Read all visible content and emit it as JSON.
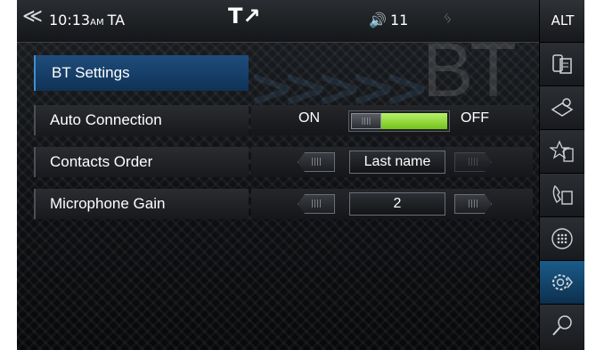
{
  "status": {
    "time": "10:13",
    "ampm": "AM",
    "station": "TA",
    "volume": "11"
  },
  "side": {
    "alt_label": "ALT",
    "buttons": [
      "phone-list-icon",
      "contacts-book-icon",
      "favorites-icon",
      "call-log-icon",
      "keypad-icon",
      "settings-icon",
      "search-icon"
    ],
    "active": "settings-icon"
  },
  "watermark": "BT",
  "page": {
    "title": "BT Settings"
  },
  "settings": {
    "auto_connection": {
      "label": "Auto Connection",
      "on_label": "ON",
      "off_label": "OFF"
    },
    "contacts_order": {
      "label": "Contacts Order",
      "value": "Last name"
    },
    "microphone_gain": {
      "label": "Microphone Gain",
      "value": "2"
    }
  },
  "colors": {
    "accent_blue": "#1f4d7c",
    "toggle_green": "#8fd63a"
  }
}
